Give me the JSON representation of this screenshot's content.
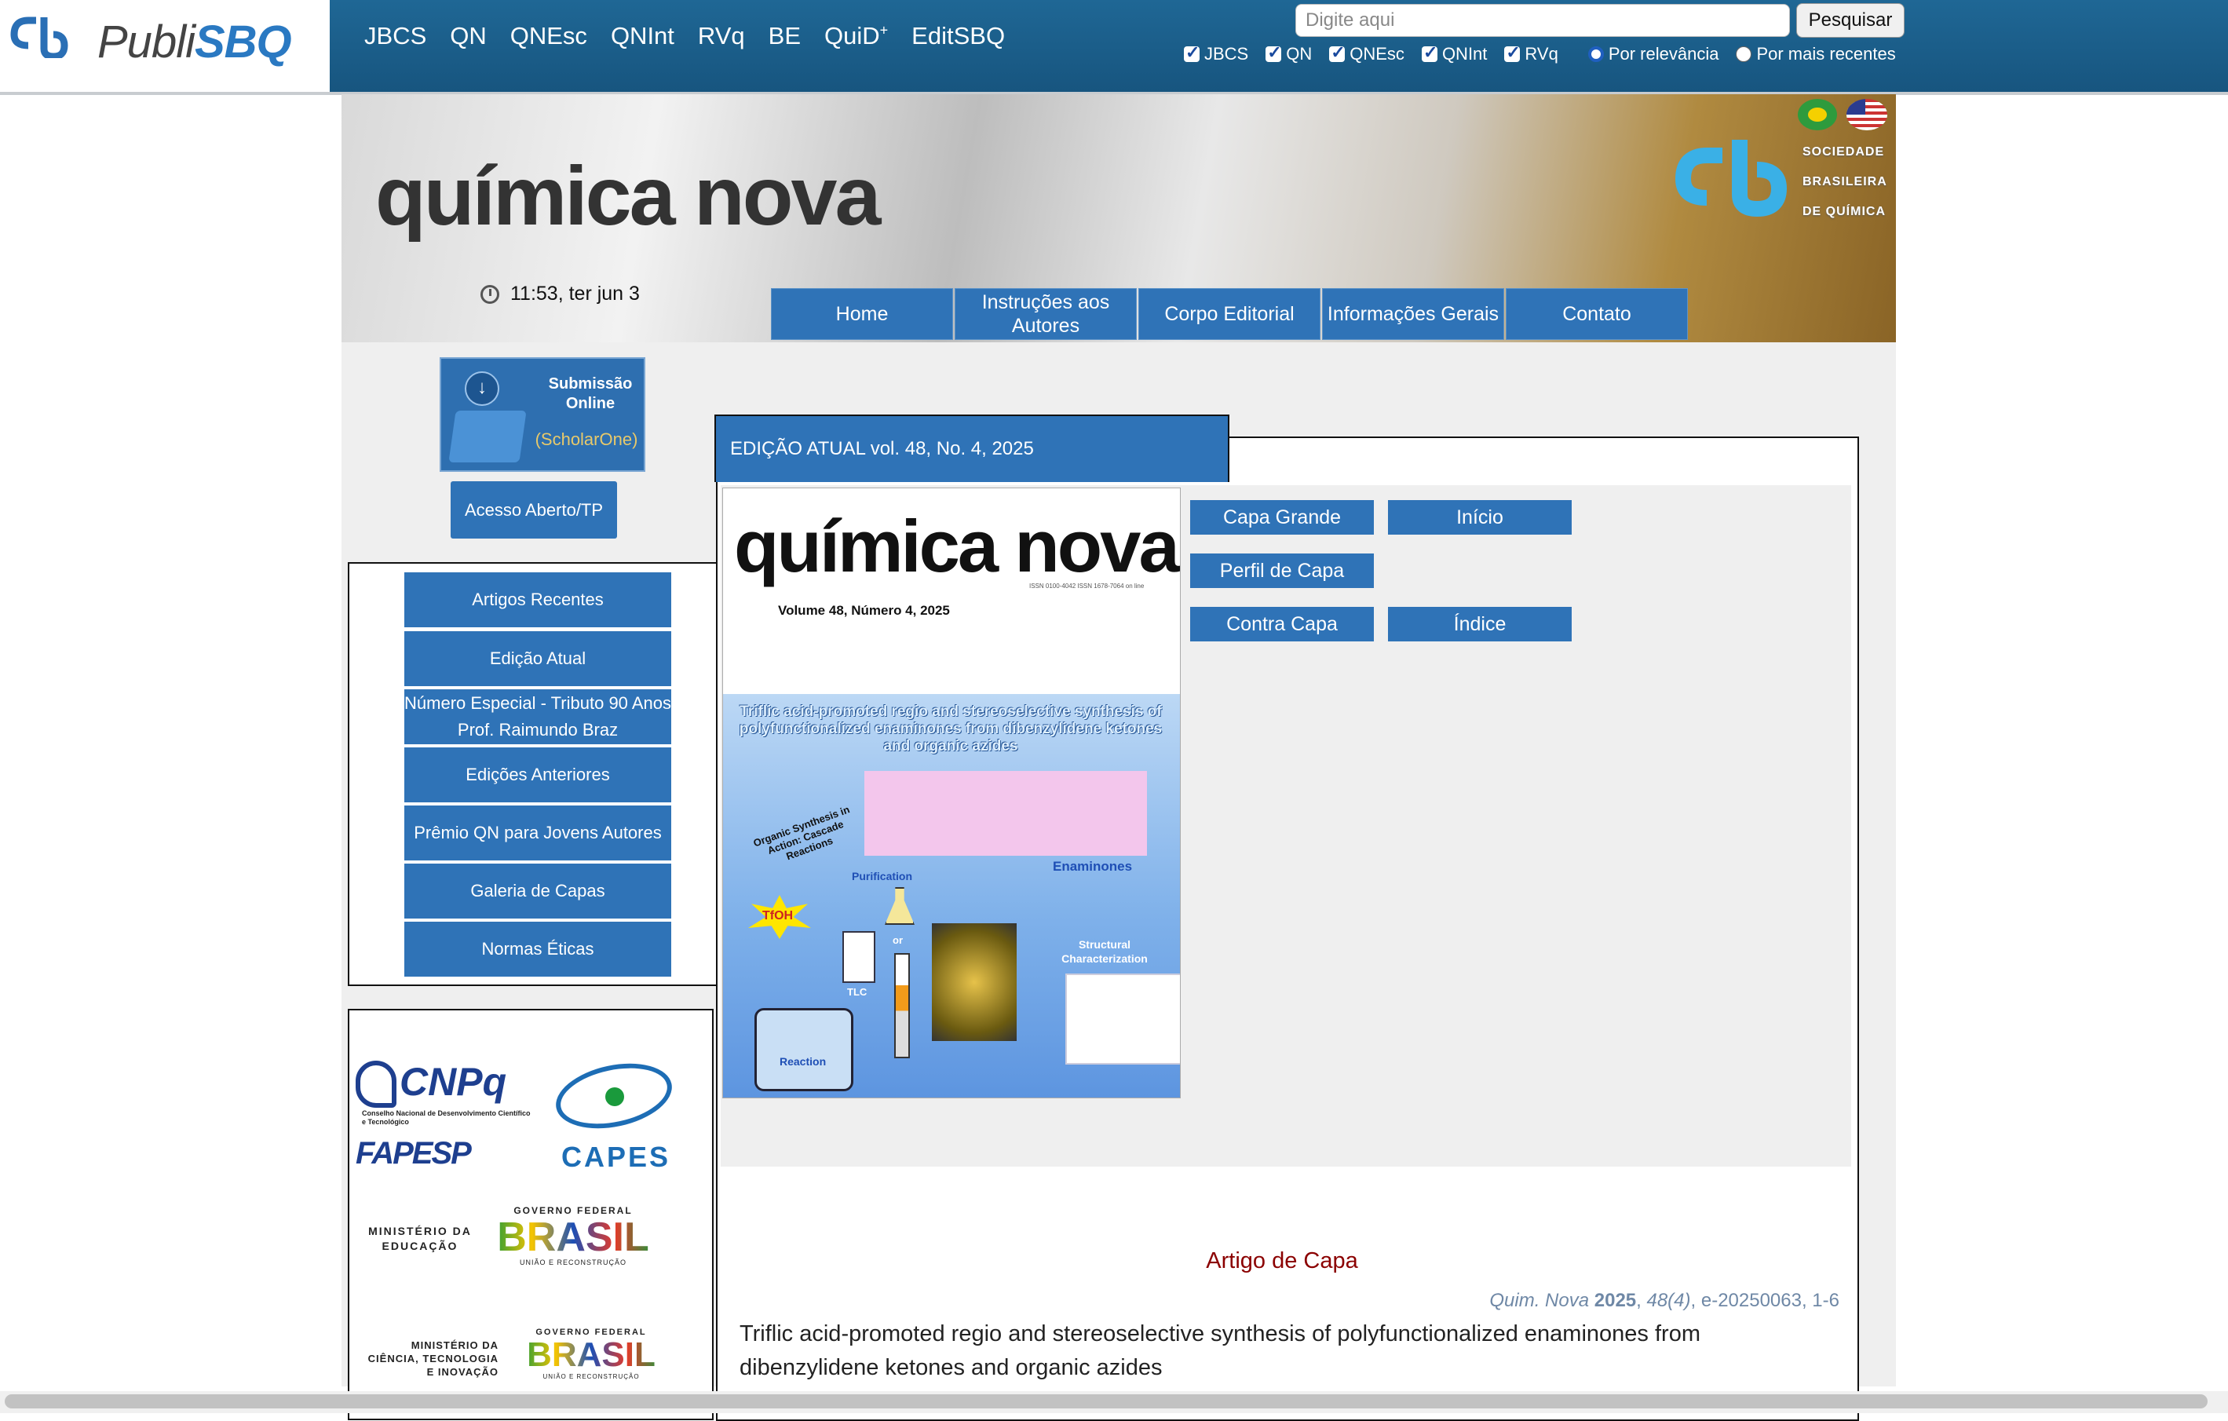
{
  "topbar": {
    "logo_part1": "Publi",
    "logo_part2": "SBQ",
    "nav": [
      "JBCS",
      "QN",
      "QNEsc",
      "QNInt",
      "RVq",
      "BE",
      "QuiD",
      "EditSBQ"
    ],
    "quid_sup": "+",
    "search_placeholder": "Digite aqui",
    "search_button": "Pesquisar",
    "filters": [
      "JBCS",
      "QN",
      "QNEsc",
      "QNInt",
      "RVq"
    ],
    "sort_options": [
      "Por relevância",
      "Por mais recentes"
    ]
  },
  "banner": {
    "title": "química nova",
    "clock": "11:53, ter jun 3",
    "sbq_text": [
      "SOCIEDADE",
      "BRASILEIRA",
      "DE QUÍMICA"
    ]
  },
  "main_nav": [
    "Home",
    "Instruções aos Autores",
    "Corpo Editorial",
    "Informações Gerais",
    "Contato"
  ],
  "submission": {
    "line1": "Submissão",
    "line2": "Online",
    "provider": "(ScholarOne)"
  },
  "acesso_aberto": "Acesso Aberto/TP",
  "sidebar": [
    "Artigos Recentes",
    "Edição Atual",
    "Número Especial - Tributo 90 Anos Prof. Raimundo Braz",
    "Edições Anteriores",
    "Prêmio QN para Jovens Autores",
    "Galeria de Capas",
    "Normas Éticas"
  ],
  "logos": {
    "cnpq": "CNPq",
    "cnpq_sub": "Conselho Nacional de Desenvolvimento Científico e Tecnológico",
    "fapesp": "FAPESP",
    "capes": "CAPES",
    "mec": "MINISTÉRIO DA EDUCAÇÃO",
    "gov": "GOVERNO FEDERAL",
    "brasil": "BRASIL",
    "gov_slogan": "UNIÃO E RECONSTRUÇÃO",
    "mcti": "MINISTÉRIO DA CIÊNCIA, TECNOLOGIA E INOVAÇÃO"
  },
  "issue": {
    "tab_label": "EDIÇÃO ATUAL vol. 48, No. 4, 2025",
    "cover_title": "química nova",
    "cover_issn": "ISSN 0100-4042 ISSN 1678-7064 on line",
    "cover_volume": "Volume 48, Número 4, 2025",
    "cover_article": "Triflic acid-promoted regio and stereoselective synthesis of polyfunctionalized enaminones from dibenzylidene ketones and organic azides",
    "cover_labels": [
      "Organic Synthesis in Action: Cascade Reactions",
      "Enaminones",
      "Purification",
      "TfOH",
      "TLC",
      "or",
      "Structural Characterization",
      "Reaction"
    ],
    "buttons": [
      "Capa Grande",
      "Início",
      "Perfil de Capa",
      "Contra Capa",
      "Índice"
    ]
  },
  "cover_article": {
    "heading": "Artigo de Capa",
    "journal": "Quim. Nova",
    "year": "2025",
    "volume": "48(4)",
    "pages": ", e-20250063, 1-6",
    "title": "Triflic acid-promoted regio and stereoselective synthesis of polyfunctionalized enaminones from dibenzylidene ketones and organic azides"
  },
  "colors": {
    "topbar": "#1f6795",
    "button": "#2f73b7",
    "accent_red": "#8b0000"
  }
}
